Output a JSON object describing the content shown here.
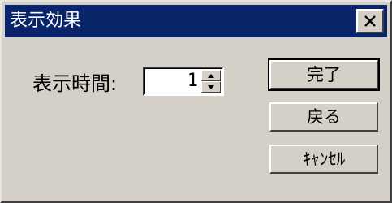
{
  "window": {
    "title": "表示効果",
    "close_label": "close"
  },
  "form": {
    "display_time_label": "表示時間:",
    "display_time_value": "1"
  },
  "buttons": {
    "ok_label": "完了",
    "back_label": "戻る",
    "cancel_label": "ｷｬﾝｾﾙ"
  },
  "icons": {
    "close": "close-icon",
    "spin_up": "arrow-up-icon",
    "spin_down": "arrow-down-icon"
  },
  "colors": {
    "titlebar": "#0a246a",
    "face": "#d4d0c8"
  }
}
